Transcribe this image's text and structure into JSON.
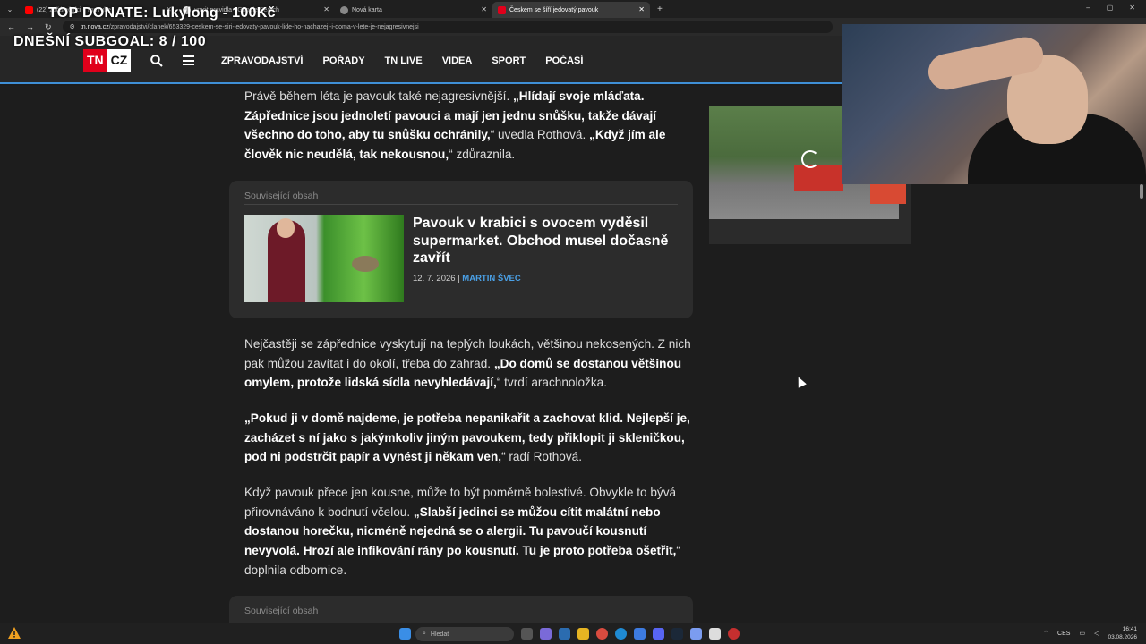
{
  "browser": {
    "tabs": [
      {
        "label": "(22) začátečníci - YouTube",
        "color": "#ff0000",
        "active": false
      },
      {
        "label": "umrit pravidla - Google Search",
        "color": "#ffffff",
        "active": false
      },
      {
        "label": "Nová karta",
        "color": "#888888",
        "active": false
      },
      {
        "label": "Českem se šíří jedovatý pavouk",
        "color": "#e0001b",
        "active": true
      }
    ],
    "new_tab": "+",
    "controls": {
      "minimize": "–",
      "maximize": "▢",
      "close": "✕"
    },
    "url_domain": "tn.nova.cz",
    "url_path": "/zpravodajstvi/clanek/653329-ceskem-se-siri-jedovaty-pavouk-lide-ho-nachazeji-i-doma-v-lete-je-nejagresivnejsi"
  },
  "stream_overlay": {
    "top_donate": "TOP DONATE: Lukylong - 100Kč",
    "subgoal": "DNEŠNÍ SUBGOAL: 8 / 100"
  },
  "site": {
    "logo_tn": "TN",
    "logo_cz": "CZ",
    "nav": [
      "ZPRAVODAJSTVÍ",
      "POŘADY",
      "TN LIVE",
      "VIDEA",
      "SPORT",
      "POČASÍ"
    ]
  },
  "article": {
    "p1_a": "Právě během léta je pavouk také nejagresivnější. ",
    "p1_b": "„Hlídají svoje mláďata. Zápřednice jsou jednoletí pavouci a mají jen jednu snůšku, takže dávají všechno do toho, aby tu snůšku ochránily,",
    "p1_c": "“ uvedla Rothová. ",
    "p1_d": "„Když jím ale člověk nic neudělá, tak nekousnou,",
    "p1_e": "“ zdůraznila.",
    "p2_a": "Nejčastěji se zápřednice vyskytují na teplých loukách, většinou nekosených. Z nich pak můžou zavítat i do okolí, třeba do zahrad. ",
    "p2_b": "„Do domů se dostanou většinou omylem, protože lidská sídla nevyhledávají,",
    "p2_c": "“ tvrdí arachnoložka.",
    "p3_a": "„Pokud ji v domě najdeme, je potřeba nepanikařit a zachovat klid. Nejlepší je, zacházet s ní jako s jakýmkoliv jiným pavoukem, tedy přiklopit ji skleničkou, pod ni podstrčit papír a vynést ji někam ven,",
    "p3_b": "“ radí Rothová.",
    "p4_a": "Když pavouk přece jen kousne, může to být poměrně bolestivé. Obvykle to bývá přirovnáváno k bodnutí včelou. ",
    "p4_b": "„Slabší jedinci se můžou cítit malátní nebo dostanou horečku, nicméně nejedná se o alergii. Tu pavoučí kousnutí nevyvolá. Hrozí ale infikování rány po kousnutí. Tu je proto potřeba ošetřit,",
    "p4_c": "“ doplnila odbornice."
  },
  "related": {
    "label": "Související obsah",
    "title": "Pavouk v krabici s ovocem vyděsil supermarket. Obchod musel dočasně zavřít",
    "date": "12. 7. 2026",
    "separator": "|",
    "author": "MARTIN ŠVEC"
  },
  "related2": {
    "label": "Související obsah"
  },
  "taskbar": {
    "search_placeholder": "Hledat",
    "language": "CES",
    "time": "16:41",
    "date": "03.08.2026"
  },
  "icons": [
    "search-icon",
    "menu-icon",
    "windows-start-icon",
    "loading-spinner-icon"
  ]
}
